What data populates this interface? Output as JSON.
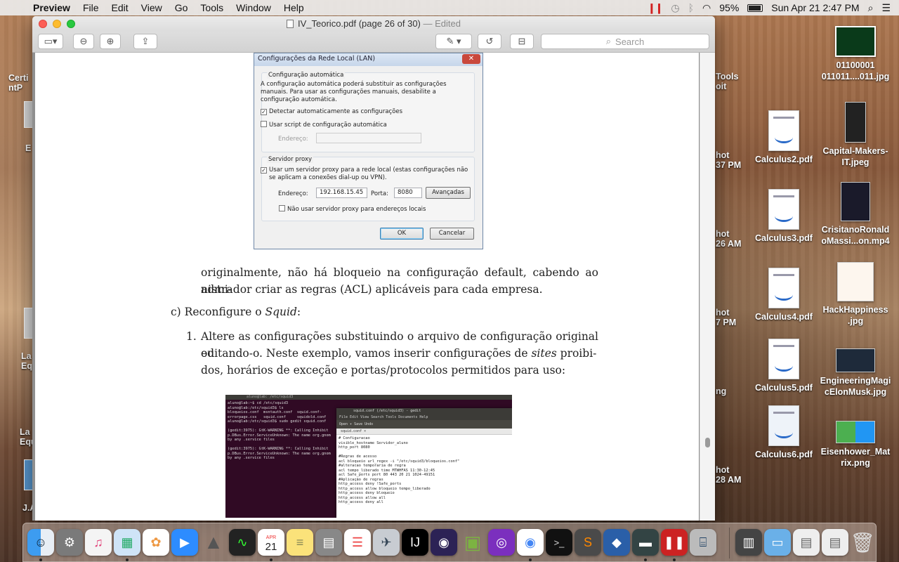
{
  "menubar": {
    "app_name": "Preview",
    "menus": [
      "File",
      "Edit",
      "View",
      "Go",
      "Tools",
      "Window",
      "Help"
    ],
    "battery": "95%",
    "datetime": "Sun Apr 21  2:47 PM"
  },
  "window": {
    "title": "IV_Teorico.pdf (page 26 of 30)",
    "edited": "— Edited",
    "search_placeholder": "Search"
  },
  "lan_dialog": {
    "title": "Configurações da Rede Local (LAN)",
    "auto_group": "Configuração automática",
    "auto_desc_1": "A configuração automática poderá substituir as configurações",
    "auto_desc_2": "manuais. Para usar as configurações manuais, desabilite a",
    "auto_desc_3": "configuração automática.",
    "detect_label": "Detectar automaticamente as configurações",
    "detect_checked": true,
    "script_label": "Usar script de configuração automática",
    "script_checked": false,
    "address_label": "Endereço:",
    "proxy_group": "Servidor proxy",
    "proxy_label_1": "Usar um servidor proxy para a rede local (estas configurações não",
    "proxy_label_2": "se aplicam a conexões dial-up ou VPN).",
    "proxy_checked": true,
    "proxy_address_label": "Endereço:",
    "proxy_address": "192.168.15.45",
    "port_label": "Porta:",
    "port": "8080",
    "advanced_label": "Avançadas",
    "bypass_label": "Não usar servidor proxy para endereços locais",
    "bypass_checked": false,
    "ok_label": "OK",
    "cancel_label": "Cancelar"
  },
  "document": {
    "para1_line1": "originalmente, não há bloqueio na configuração default, cabendo ao admi-",
    "para1_line2": "nistrador criar as regras (ACL) aplicáveis para cada empresa.",
    "step_c_prefix": "c) Reconfigure o ",
    "step_c_italic": "Squid",
    "step_c_suffix": ":",
    "item_num": "1.",
    "item_line1": "Altere as configurações substituindo o arquivo de configuração original ou",
    "item_line2_a": "editando-o. Neste exemplo, vamos inserir configurações de ",
    "item_line2_italic": "sites",
    "item_line2_b": " proibi-",
    "item_line3": "dos, horários de exceção e portas/protocolos permitidos para uso:"
  },
  "terminal": {
    "title": "aluno@lab: /etc/squid3",
    "lines": [
      "aluno@lab:~$ cd /etc/squid3",
      "aluno@lab:/etc/squid3$ ls",
      "bloqueios.conf  msntauth.conf  squid.conf-",
      "errorpage.css   squid.conf     squidold.conf",
      "aluno@lab:/etc/squid3$ sudo gedit squid.conf",
      "",
      "(gedit:3975): GtK-WARNING **: Calling Inhibit",
      "p.DBus.Error.ServiceUnknown: The name org.gnom",
      "by any .service files",
      "",
      "(gedit:3975): GtK-WARNING **: Calling Inhibit",
      "p.DBus.Error.ServiceUnknown: The name org.gnom",
      "by any .service files"
    ],
    "gedit_title": "squid.conf (/etc/squid3) - gedit",
    "gedit_menu": "File  Edit  View  Search  Tools  Documents  Help",
    "gedit_tools": "Open  ▾   Save     Undo",
    "gedit_tab": "squid.conf  ×",
    "gedit_lines": [
      "# Configuracao",
      "visible_hostname Servidor_aluno",
      "http_port 8080",
      "",
      "#Regras de acesso",
      "acl bloqueio url_regex -i \"/etc/squid3/bloqueios.conf\"",
      "#alteracao temporaria de regra",
      "acl tempo_liberado time MTWHFAS 11:30-12:45",
      "acl Safe_ports port 80 443 20 21 1024-49151",
      "#Aplicação de regras",
      "http_access deny !Safe_ports",
      "http_access allow bloqueio tempo_liberado",
      "http_access deny bloqueio",
      "http_access allow all",
      "http_access deny all"
    ]
  },
  "desktop_icons": [
    {
      "label": "01100001\n011011....011.jpg"
    },
    {
      "label": "Calculus2.pdf"
    },
    {
      "label": "Capital-Makers-\nIT.jpeg"
    },
    {
      "label": "Calculus3.pdf"
    },
    {
      "label": "CrisitanoRonald\noMassi...on.mp4"
    },
    {
      "label": "Calculus4.pdf"
    },
    {
      "label": "HackHappiness\n.jpg"
    },
    {
      "label": "Calculus5.pdf"
    },
    {
      "label": "EngineeringMagi\ncElonMusk.jpg"
    },
    {
      "label": "Calculus6.pdf"
    },
    {
      "label": "Eisenhower_Mat\nrix.png"
    }
  ],
  "dock_calendar": {
    "month": "APR",
    "day": "21"
  }
}
